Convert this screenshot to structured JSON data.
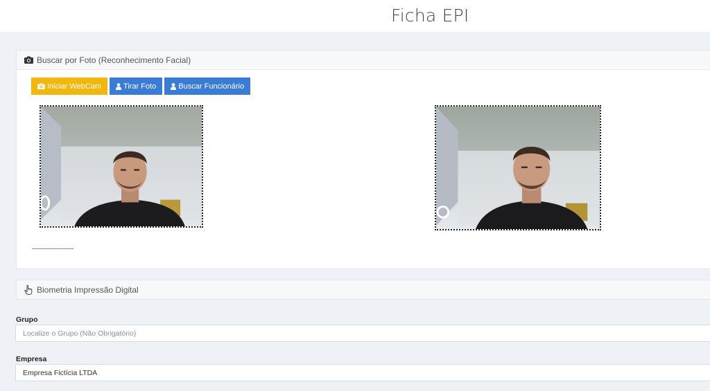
{
  "header": {
    "title": "Ficha EPI"
  },
  "photo_panel": {
    "title": "Buscar por Foto (Reconhecimento Facial)",
    "icon": "camera-icon",
    "buttons": [
      {
        "label": "Iniciar WebCam",
        "icon": "camera-icon",
        "color": "#f2b70c"
      },
      {
        "label": "Tirar Foto",
        "icon": "user-icon",
        "color": "#3a7bd5"
      },
      {
        "label": "Buscar Funcionário",
        "icon": "user-icon",
        "color": "#3a7bd5"
      }
    ],
    "result_text": "------------------------"
  },
  "biometric_panel": {
    "title": "Biometria Impressão Digital",
    "icon": "hand-pointer-icon"
  },
  "form": {
    "grupo": {
      "label": "Grupo",
      "placeholder": "Localize o Grupo (Não Obrigatório)",
      "value": ""
    },
    "empresa": {
      "label": "Empresa",
      "value": "Empresa Fictícia LTDA"
    }
  }
}
